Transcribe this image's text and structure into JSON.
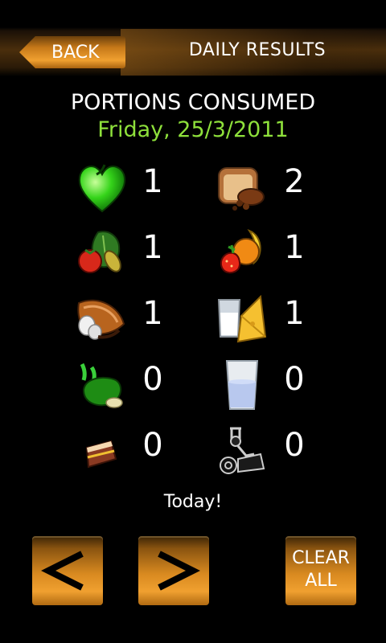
{
  "header": {
    "back_label": "BACK",
    "title": "DAILY RESULTS"
  },
  "summary": {
    "heading": "PORTIONS CONSUMED",
    "date": "Friday, 25/3/2011",
    "date_color": "#8ee03b"
  },
  "portions": [
    {
      "icon": "heart-icon",
      "count": "1"
    },
    {
      "icon": "bread-icon",
      "count": "2"
    },
    {
      "icon": "vegetables-icon",
      "count": "1"
    },
    {
      "icon": "fruit-icon",
      "count": "1"
    },
    {
      "icon": "meat-eggs-icon",
      "count": "1"
    },
    {
      "icon": "dairy-icon",
      "count": "1"
    },
    {
      "icon": "oils-fats-icon",
      "count": "0"
    },
    {
      "icon": "water-glass-icon",
      "count": "0"
    },
    {
      "icon": "cake-slice-icon",
      "count": "0"
    },
    {
      "icon": "exercise-icon",
      "count": "0"
    }
  ],
  "status": "Today!",
  "footer": {
    "prev_icon": "chevron-left-icon",
    "next_icon": "chevron-right-icon",
    "clear_line1": "CLEAR",
    "clear_line2": "ALL"
  },
  "colors": {
    "accent_orange": "#e8962a",
    "background": "#000000",
    "date_green": "#8ee03b"
  }
}
